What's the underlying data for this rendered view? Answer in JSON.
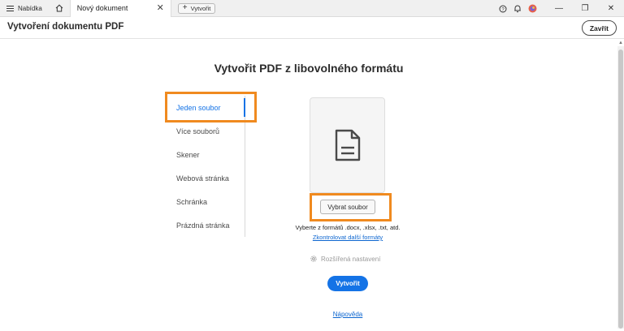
{
  "tabbar": {
    "menu_label": "Nabídka",
    "tab_title": "Nový dokument",
    "tab_close": "✕",
    "new_tab_label": "Vytvořit"
  },
  "window": {
    "minimize": "—",
    "restore": "❐",
    "close": "✕"
  },
  "header": {
    "title": "Vytvoření dokumentu PDF",
    "close_label": "Zavřít"
  },
  "main": {
    "title": "Vytvořit PDF z libovolného formátu",
    "options": [
      {
        "label": "Jeden soubor",
        "active": true
      },
      {
        "label": "Více souborů",
        "active": false
      },
      {
        "label": "Skener",
        "active": false
      },
      {
        "label": "Webová stránka",
        "active": false
      },
      {
        "label": "Schránka",
        "active": false
      },
      {
        "label": "Prázdná stránka",
        "active": false
      }
    ],
    "choose_file": "Vybrat soubor",
    "formats_text": "Vyberte z formátů .docx, .xlsx, .txt, atd.",
    "formats_link": "Zkontrolovat další formáty",
    "advanced": "Rozšířená nastavení",
    "create": "Vytvořit",
    "help": "Nápověda"
  },
  "colors": {
    "accent": "#1473e6",
    "highlight": "#f08a1f"
  }
}
